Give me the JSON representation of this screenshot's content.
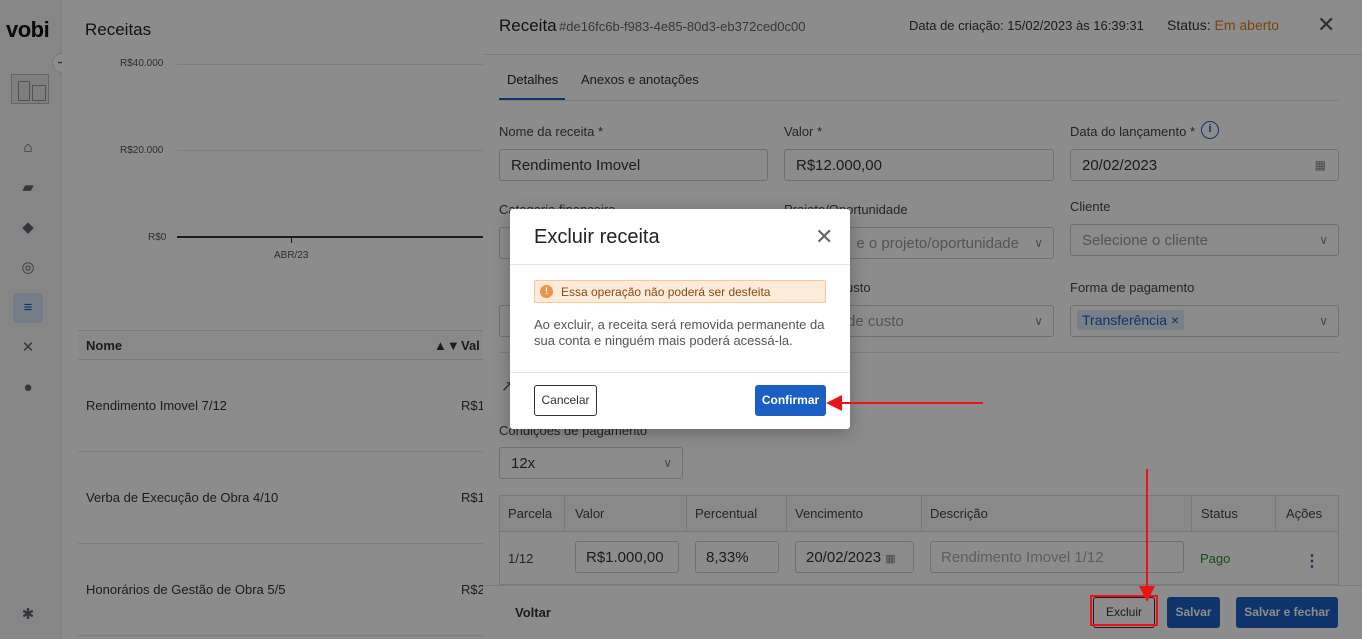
{
  "app": {
    "logo": "vobi",
    "page_title": "Receitas",
    "chart": {
      "ticks_y": [
        "R$40.000",
        "R$20.000",
        "R$0"
      ],
      "ticks_x": [
        "ABR/23"
      ]
    },
    "table": {
      "headers": [
        "Nome",
        "Val"
      ],
      "rows": [
        {
          "name": "Rendimento Imovel 7/12",
          "value": "R$1"
        },
        {
          "name": "Verba de Execução de Obra 4/10",
          "value": "R$1"
        },
        {
          "name": "Honorários de Gestão de Obra 5/5",
          "value": "R$2"
        }
      ]
    },
    "sidebar_icons": [
      "home-icon",
      "folder-icon",
      "tag-icon",
      "compass-icon",
      "coins-icon",
      "tools-icon",
      "users-icon",
      "settings-icon"
    ]
  },
  "drawer": {
    "title": "Receita",
    "id": "#de16fc6b-f983-4e85-80d3-eb372ced0c00",
    "created": "Data de criação: 15/02/2023 às 16:39:31",
    "status_label": "Status:",
    "status_value": "Em aberto",
    "tabs": [
      "Detalhes",
      "Anexos e anotações"
    ],
    "fields": {
      "nome_label": "Nome da receita *",
      "nome_value": "Rendimento Imovel",
      "valor_label": "Valor *",
      "valor_value": "R$12.000,00",
      "data_label": "Data do lançamento *",
      "data_value": "20/02/2023",
      "categoria_label": "Categoria financeira",
      "projeto_label": "Projeto/Oportunidade",
      "projeto_placeholder": "e o projeto/oportunidade",
      "cliente_label": "Cliente",
      "cliente_placeholder": "Selecione o cliente",
      "centro_label": "usto",
      "centro_placeholder": "de custo",
      "forma_label": "Forma de pagamento",
      "forma_tag": "Transferência",
      "condicoes_label": "Condições de pagamento",
      "condicoes_value": "12x"
    },
    "grid": {
      "headers": [
        "Parcela",
        "Valor",
        "Percentual",
        "Vencimento",
        "Descrição",
        "Status",
        "Ações"
      ],
      "row": {
        "parcela": "1/12",
        "valor": "R$1.000,00",
        "percentual": "8,33%",
        "vencimento": "20/02/2023",
        "descricao_placeholder": "Rendimento Imovel 1/12",
        "status": "Pago"
      }
    },
    "footer": {
      "back": "Voltar",
      "delete": "Excluir",
      "save": "Salvar",
      "save_close": "Salvar e fechar"
    }
  },
  "modal": {
    "title": "Excluir receita",
    "warning": "Essa operação não poderá ser desfeita",
    "body": "Ao excluir, a receita será removida permanente da sua conta e ninguém mais poderá acessá-la.",
    "cancel": "Cancelar",
    "confirm": "Confirmar"
  },
  "colors": {
    "accent": "#1b5fc4",
    "status_open": "#e07b18",
    "annotation": "#e8141a",
    "paid": "#2f8a2f"
  }
}
